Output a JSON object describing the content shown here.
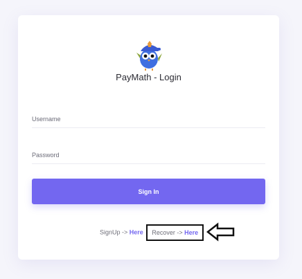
{
  "app": {
    "title": "PayMath - Login",
    "logo_icon": "owl-mascot-icon"
  },
  "form": {
    "username_placeholder": "Username",
    "password_placeholder": "Password",
    "sign_in_label": "Sign In"
  },
  "footer": {
    "signup_text": "SignUp ->",
    "signup_link": "Here",
    "recover_text": "Recover ->",
    "recover_link": "Here"
  },
  "annotation": {
    "arrow_icon": "left-arrow-icon"
  },
  "colors": {
    "accent": "#7367f0",
    "background": "#f5f5fb",
    "card": "#ffffff"
  }
}
